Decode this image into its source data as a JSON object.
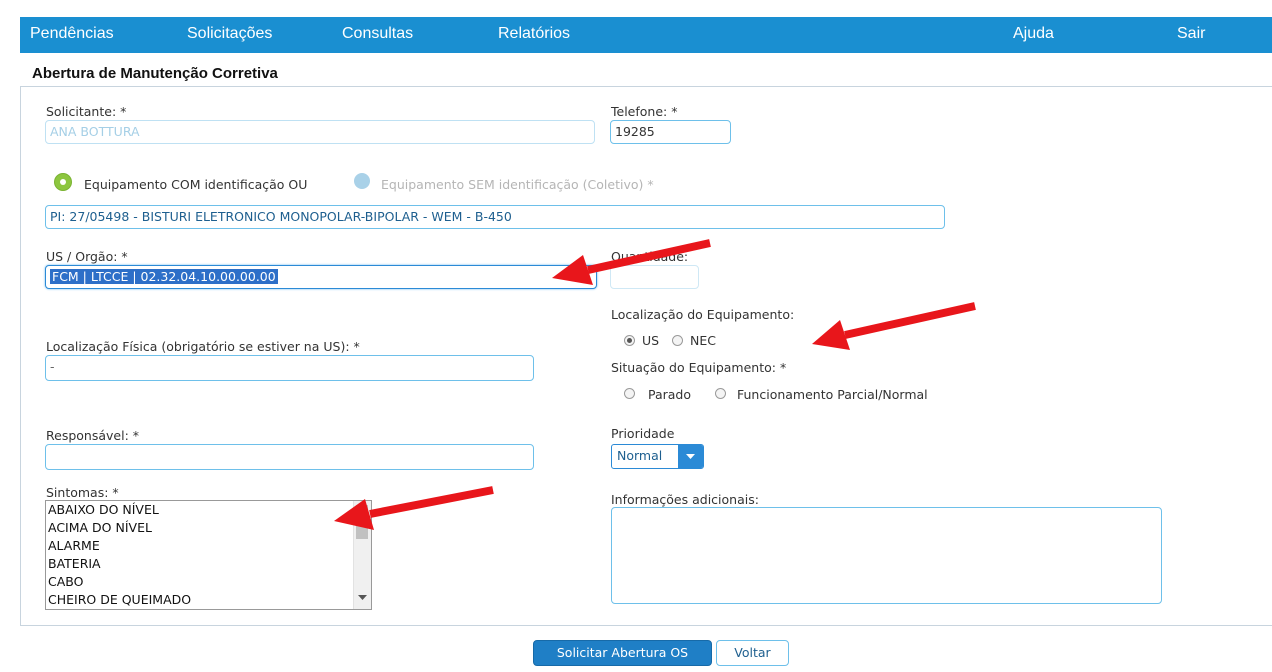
{
  "nav": {
    "pendencias": "Pendências",
    "solicitacoes": "Solicitações",
    "consultas": "Consultas",
    "relatorios": "Relatórios",
    "ajuda": "Ajuda",
    "sair": "Sair"
  },
  "page_title": "Abertura de Manutenção Corretiva",
  "form": {
    "solicitante_label": "Solicitante: *",
    "solicitante_value": "ANA BOTTURA",
    "telefone_label": "Telefone: *",
    "telefone_value": "19285",
    "equip_com_label": "Equipamento COM identificação OU",
    "equip_sem_label": "Equipamento SEM identificação (Coletivo) *",
    "equipamento_value": "PI: 27/05498 - BISTURI ELETRONICO MONOPOLAR-BIPOLAR - WEM - B-450",
    "us_orgao_label": "US / Orgão: *",
    "us_orgao_value": "FCM | LTCCE | 02.32.04.10.00.00.00",
    "quantidade_label": "Quantidade:",
    "quantidade_value": "",
    "localizacao_equip_label": "Localização do Equipamento:",
    "loc_us": "US",
    "loc_nec": "NEC",
    "localizacao_fisica_label": "Localização Física (obrigatório se estiver na US): *",
    "localizacao_fisica_value": "-",
    "situacao_label": "Situação do Equipamento: *",
    "situacao_parado": "Parado",
    "situacao_funcionamento": "Funcionamento Parcial/Normal",
    "responsavel_label": "Responsável: *",
    "responsavel_value": "",
    "prioridade_label": "Prioridade",
    "prioridade_value": "Normal",
    "sintomas_label": "Sintomas: *",
    "sintomas_options": [
      "ABAIXO DO NÍVEL",
      "ACIMA DO NÍVEL",
      "ALARME",
      "BATERIA",
      "CABO",
      "CHEIRO DE QUEIMADO"
    ],
    "info_label": "Informações adicionais:",
    "info_value": ""
  },
  "buttons": {
    "solicitar": "Solicitar Abertura OS",
    "voltar": "Voltar"
  },
  "colors": {
    "nav_bg": "#1a8fd1",
    "accent": "#2b8ad6",
    "annotation_arrow": "#e8161b",
    "radio_selected": "#8dc63f"
  },
  "selected": {
    "equipamento_mode": "COM",
    "localizacao": "US",
    "situacao": ""
  }
}
